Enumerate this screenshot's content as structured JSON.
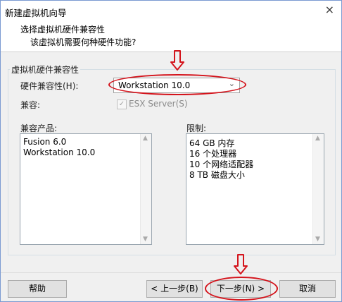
{
  "window": {
    "title": "新建虚拟机向导",
    "close_glyph": "×"
  },
  "header": {
    "title": "选择虚拟机硬件兼容性",
    "subtitle": "该虚拟机需要何种硬件功能?"
  },
  "group": {
    "label": "虚拟机硬件兼容性"
  },
  "hardware": {
    "label": "硬件兼容性(H):",
    "selected": "Workstation 10.0",
    "chevron": "⌄"
  },
  "compat": {
    "label": "兼容:",
    "checkbox_label": "ESX Server(S)",
    "checked": true,
    "check_glyph": "✓"
  },
  "products": {
    "label": "兼容产品:",
    "items": [
      "Fusion 6.0",
      "Workstation 10.0"
    ]
  },
  "limits": {
    "label": "限制:",
    "items": [
      "64 GB 内存",
      "16 个处理器",
      "10 个网络适配器",
      "8 TB 磁盘大小"
    ]
  },
  "scroll": {
    "up": "▲",
    "down": "▼"
  },
  "buttons": {
    "help": "帮助",
    "back": "< 上一步(B)",
    "next": "下一步(N) >",
    "cancel": "取消"
  },
  "annotation": {
    "color": "#d4141c"
  }
}
